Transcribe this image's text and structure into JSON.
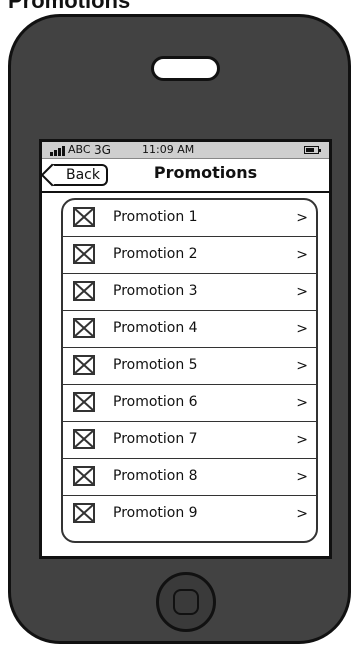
{
  "window_title": "Promotions",
  "status_bar": {
    "carrier": "ABC",
    "network": "3G",
    "time": "11:09 AM"
  },
  "nav": {
    "back_label": "Back",
    "title": "Promotions"
  },
  "list": [
    {
      "label": "Promotion 1"
    },
    {
      "label": "Promotion 2"
    },
    {
      "label": "Promotion 3"
    },
    {
      "label": "Promotion 4"
    },
    {
      "label": "Promotion 5"
    },
    {
      "label": "Promotion 6"
    },
    {
      "label": "Promotion 7"
    },
    {
      "label": "Promotion 8"
    },
    {
      "label": "Promotion 9"
    }
  ],
  "icons": {
    "row_image": "image-placeholder-icon",
    "row_arrow": "chevron-right-icon",
    "signal": "signal-bars-icon",
    "battery": "battery-icon"
  }
}
